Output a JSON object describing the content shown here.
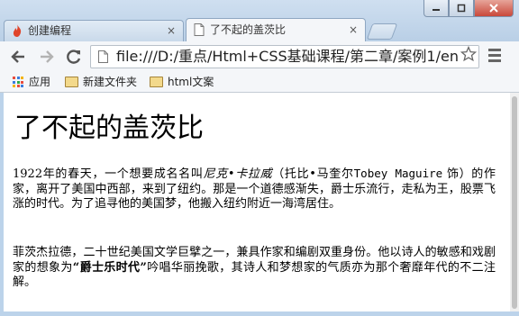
{
  "browser": {
    "tabs": [
      {
        "label": "创建编程",
        "active": false,
        "icon": "flame-icon"
      },
      {
        "label": "了不起的盖茨比",
        "active": true,
        "icon": "page-icon"
      }
    ],
    "tab_close_glyph": "×",
    "address_bar": {
      "url": "file:///D:/重点/Html+CSS基础课程/第二章/案例1/en"
    },
    "bookmarks": [
      {
        "label": "应用",
        "icon": "apps-icon"
      },
      {
        "label": "新建文件夹",
        "icon": "folder-icon"
      },
      {
        "label": "html文案",
        "icon": "folder-icon"
      }
    ]
  },
  "page": {
    "title": "了不起的盖茨比",
    "paragraph1": {
      "before_em": "1922年的春天，一个想要成名名叫",
      "em": "尼克•卡拉威",
      "after_em": "（托比•马奎尔",
      "mono": "Tobey Maguire",
      "rest": " 饰）的作家，离开了美国中西部，来到了纽约。那是一个道德感渐失，爵士乐流行，走私为王，股票飞涨的时代。为了追寻他的美国梦，他搬入纽约附近一海湾居住。"
    },
    "paragraph2": {
      "before_strong": "菲茨杰拉德，二十世纪美国文学巨擘之一，兼具作家和编剧双重身份。他以诗人的敏感和戏剧家的想象为",
      "strong": "“爵士乐时代”",
      "after_strong": "吟唱华丽挽歌，其诗人和梦想家的气质亦为那个奢靡年代的不二注解。"
    }
  },
  "colors": {
    "frame": "#bcd3ea",
    "toolbar": "#f4f6f9",
    "close_button": "#c9483a"
  }
}
